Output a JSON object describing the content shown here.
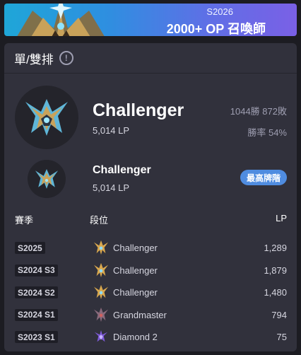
{
  "banner": {
    "season": "S2026",
    "title": "2000+ OP 召喚師"
  },
  "card": {
    "title": "單/雙排",
    "info_icon": "info-icon"
  },
  "current": {
    "tier": "Challenger",
    "lp": "5,014 LP",
    "win_loss": "1044勝 872敗",
    "win_rate": "勝率 54%"
  },
  "peak": {
    "tier": "Challenger",
    "lp": "5,014 LP",
    "badge": "最高牌階"
  },
  "table": {
    "headers": {
      "season": "賽季",
      "tier": "段位",
      "lp": "LP"
    },
    "rows": [
      {
        "season": "S2025",
        "tier": "Challenger",
        "lp": "1,289",
        "icon": "challenger-icon"
      },
      {
        "season": "S2024 S3",
        "tier": "Challenger",
        "lp": "1,879",
        "icon": "challenger-icon"
      },
      {
        "season": "S2024 S2",
        "tier": "Challenger",
        "lp": "1,480",
        "icon": "challenger-icon"
      },
      {
        "season": "S2024 S1",
        "tier": "Grandmaster",
        "lp": "794",
        "icon": "grandmaster-icon"
      },
      {
        "season": "S2023 S1",
        "tier": "Diamond 2",
        "lp": "75",
        "icon": "diamond-icon"
      }
    ]
  },
  "colors": {
    "challenger": "#e0b45a",
    "grandmaster": "#9a7a8a",
    "diamond": "#7e5ad8",
    "accent": "#4f8ce0"
  }
}
